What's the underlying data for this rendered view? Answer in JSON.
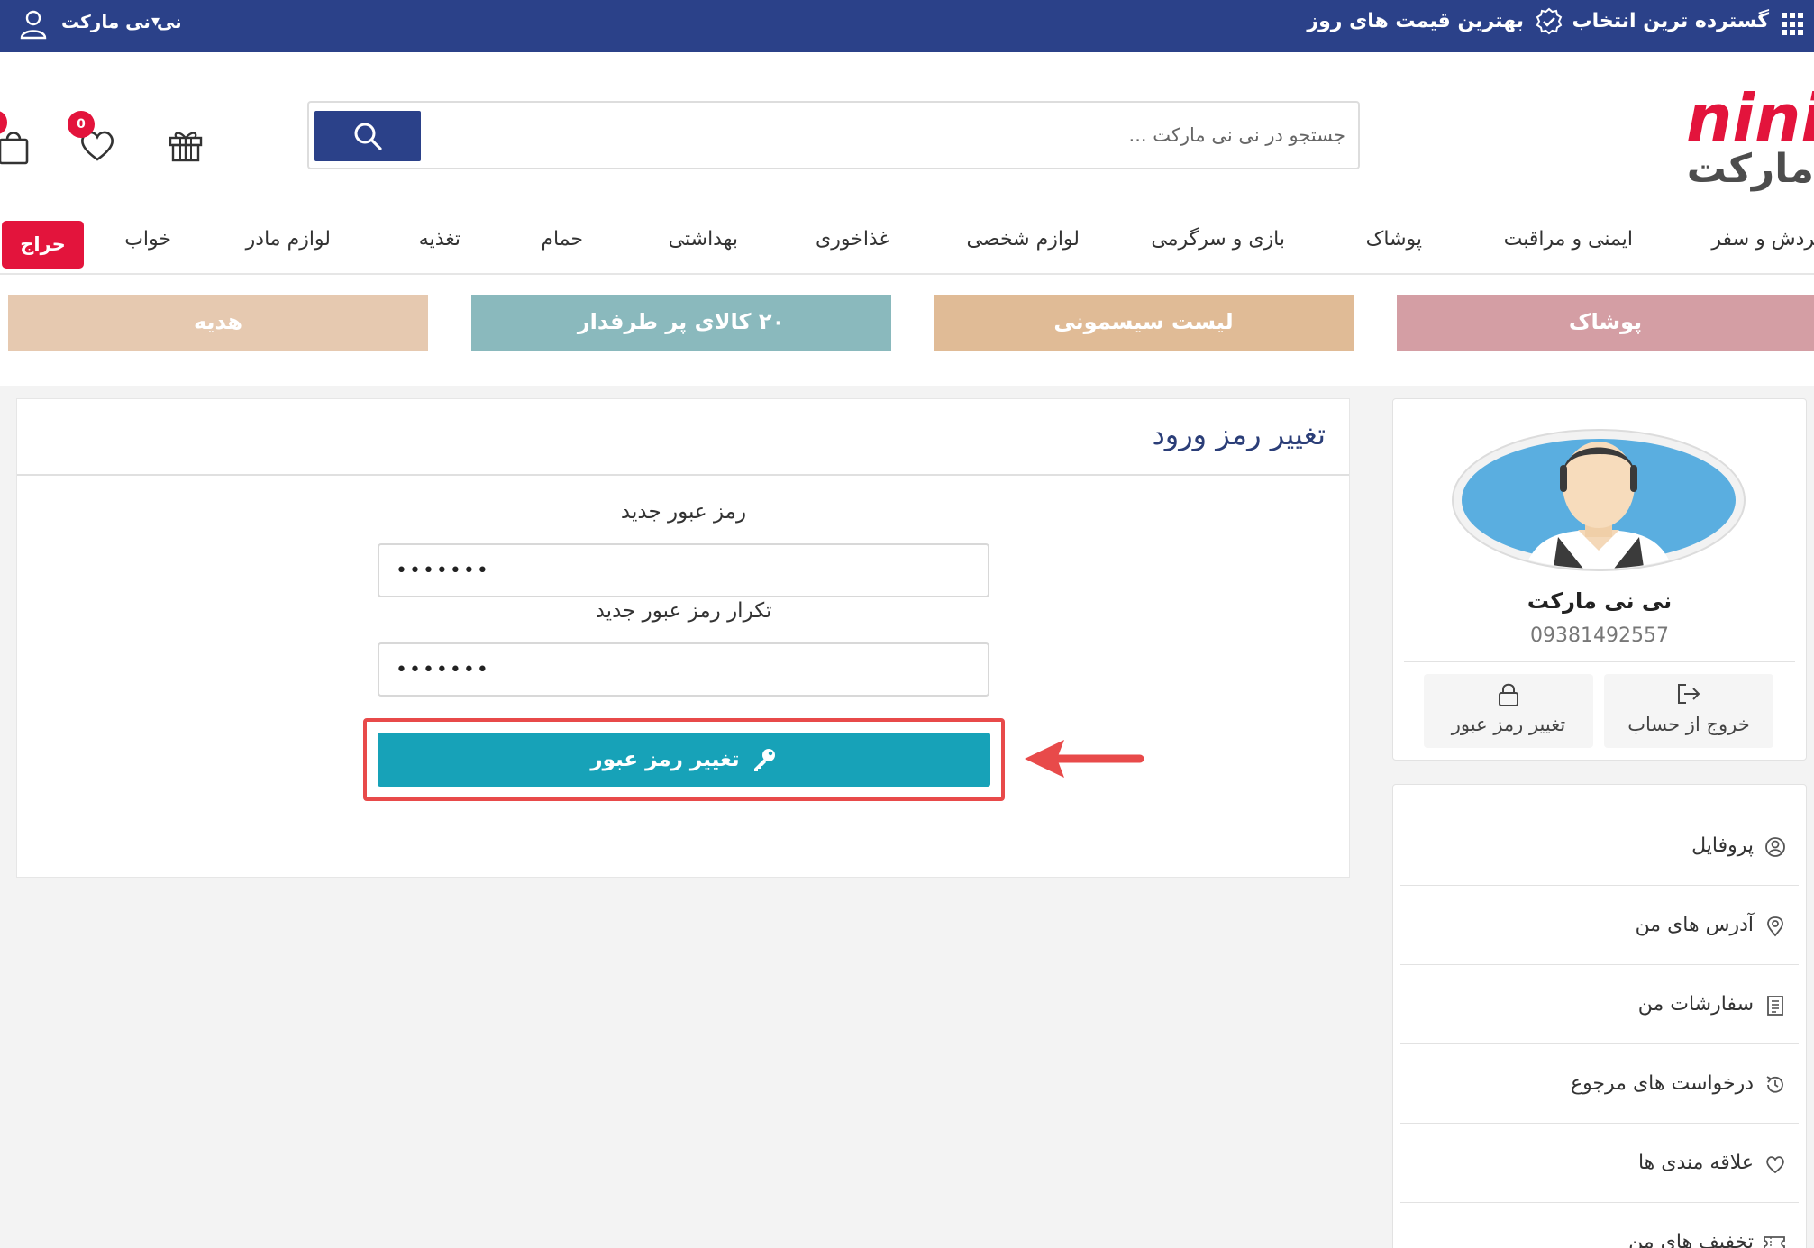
{
  "topbar": {
    "feature_1": "گسترده ترین انتخاب",
    "feature_2": "بهترین قیمت های روز",
    "account_name": "نی نی مارکت",
    "account_caret": "▾"
  },
  "header": {
    "logo_alt": "nini مارکت",
    "search_placeholder": "جستجو در نی نی مارکت ...",
    "icons": [
      "search-icon",
      "gift-icon",
      "heart-icon",
      "cart-icon"
    ],
    "wishlist_badge": "0"
  },
  "nav": {
    "items": [
      "گردش و سفر",
      "ایمنی و مراقبت",
      "پوشاک",
      "بازی و سرگرمی",
      "لوازم شخصی",
      "غذاخوری",
      "بهداشتی",
      "حمام",
      "تغذیه",
      "لوازم مادر",
      "خواب"
    ],
    "sale": "حراج"
  },
  "banners": [
    {
      "label": "پوشاک",
      "color": "#d49ea4"
    },
    {
      "label": "لیست سیسمونی",
      "color": "#e0bb96"
    },
    {
      "label": "۲۰ کالای پر طرفدار",
      "color": "#8ab9bd"
    },
    {
      "label": "هدیه",
      "color": "#e6c9b0"
    }
  ],
  "profile": {
    "name": "نی نی مارکت",
    "phone": "09381492557",
    "logout": "خروج از حساب",
    "change_password": "تغییر رمز عبور"
  },
  "menu": {
    "items": [
      {
        "label": "پروفایل",
        "icon": "user-circle-icon"
      },
      {
        "label": "آدرس های من",
        "icon": "location-pin-icon"
      },
      {
        "label": "سفارشات من",
        "icon": "receipt-icon"
      },
      {
        "label": "درخواست های مرجوع",
        "icon": "history-icon"
      },
      {
        "label": "علاقه مندی ها",
        "icon": "heart-icon"
      },
      {
        "label": "تخفیف های من",
        "icon": "ticket-icon"
      }
    ]
  },
  "form": {
    "title": "تغییر رمز ورود",
    "new_password_label": "رمز عبور جدید",
    "new_password_value": "•••••••",
    "confirm_password_label": "تکرار رمز عبور جدید",
    "confirm_password_value": "•••••••",
    "submit_label": "تغییر رمز عبور"
  },
  "colors": {
    "brand_blue": "#2b4189",
    "brand_pink": "#e3143c",
    "submit_teal": "#17a2b8",
    "highlight_red": "#e84a4a"
  }
}
